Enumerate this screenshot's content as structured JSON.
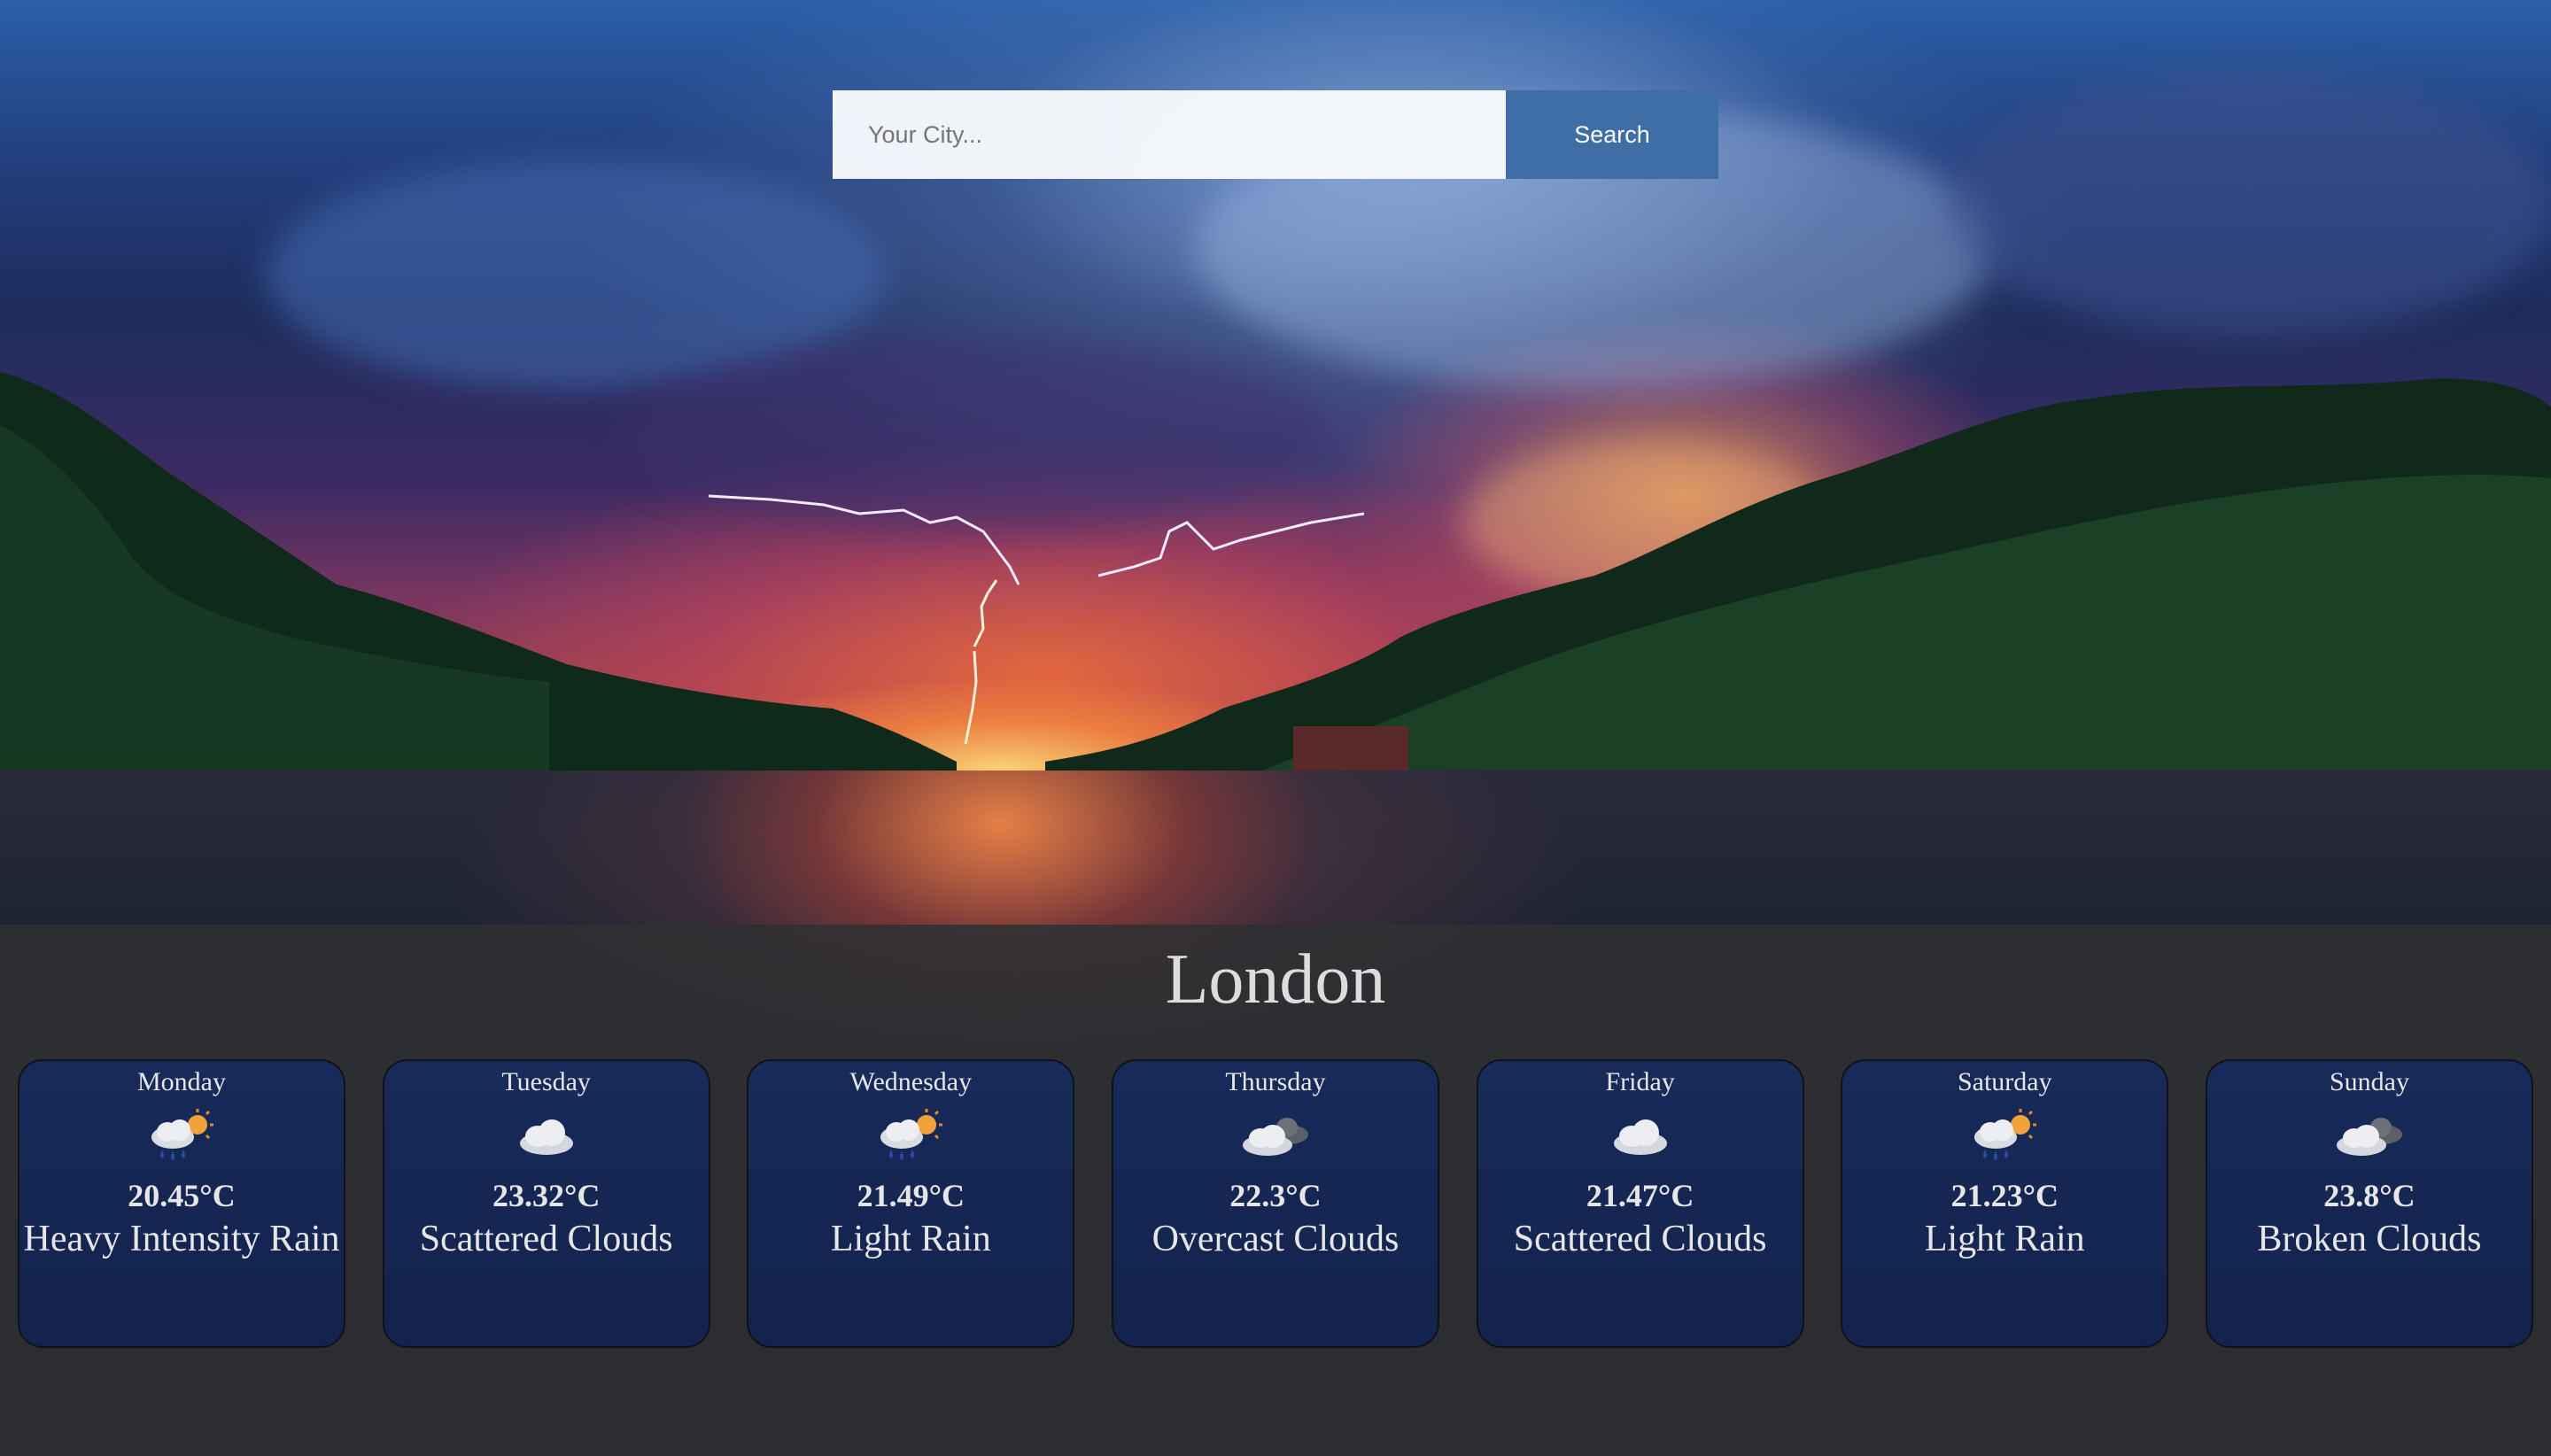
{
  "search": {
    "placeholder": "Your City...",
    "button_label": "Search"
  },
  "city": "London",
  "forecast": [
    {
      "day": "Monday",
      "icon": "rain-sun-icon",
      "temp": "20.45°C",
      "desc": "Heavy Intensity Rain"
    },
    {
      "day": "Tuesday",
      "icon": "cloud-icon",
      "temp": "23.32°C",
      "desc": "Scattered Clouds"
    },
    {
      "day": "Wednesday",
      "icon": "rain-sun-icon",
      "temp": "21.49°C",
      "desc": "Light Rain"
    },
    {
      "day": "Thursday",
      "icon": "dark-clouds-icon",
      "temp": "22.3°C",
      "desc": "Overcast Clouds"
    },
    {
      "day": "Friday",
      "icon": "cloud-icon",
      "temp": "21.47°C",
      "desc": "Scattered Clouds"
    },
    {
      "day": "Saturday",
      "icon": "rain-sun-icon",
      "temp": "21.23°C",
      "desc": "Light Rain"
    },
    {
      "day": "Sunday",
      "icon": "dark-clouds-icon",
      "temp": "23.8°C",
      "desc": "Broken Clouds"
    }
  ],
  "colors": {
    "search_button": "#3f6da6",
    "card_bg": "#162a5c",
    "panel_bg": "#303032"
  }
}
